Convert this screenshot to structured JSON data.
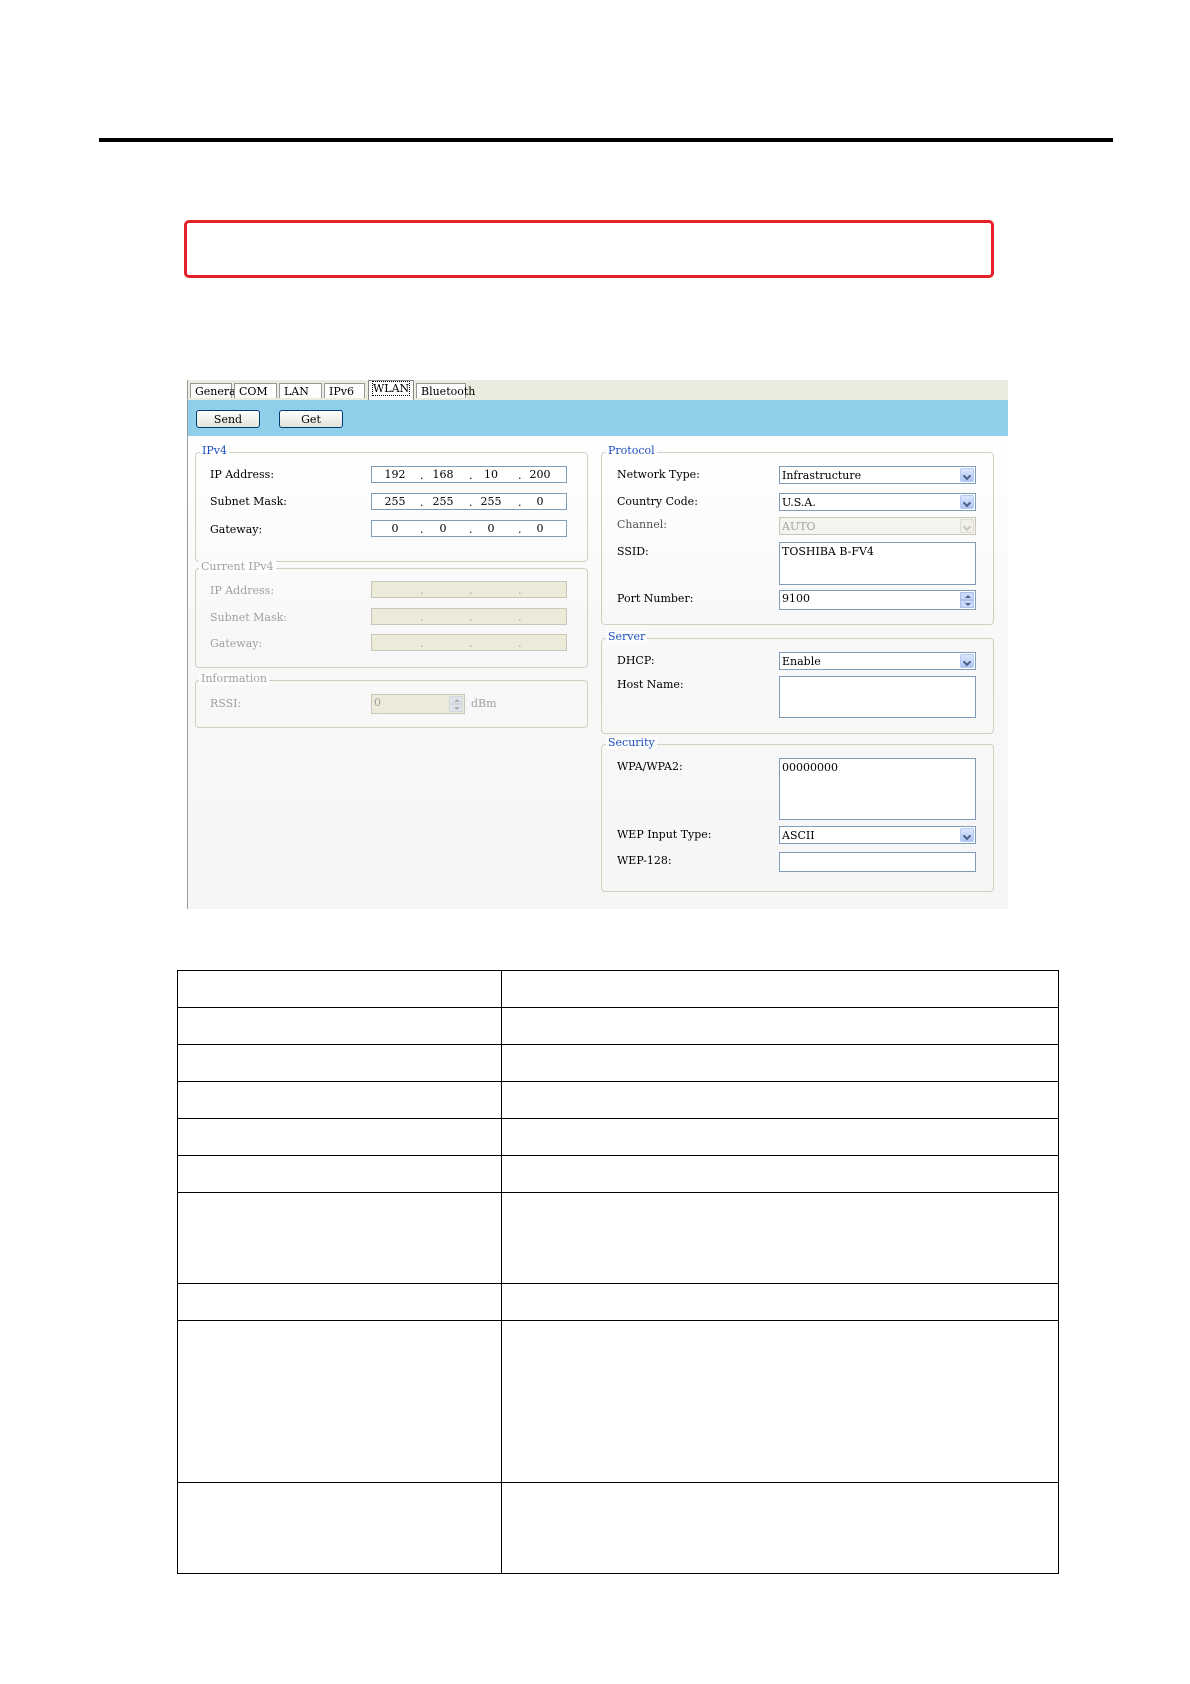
{
  "tabs": [
    "General",
    "COM",
    "LAN",
    "IPv6",
    "WLAN",
    "Bluetooth"
  ],
  "active_tab": "WLAN",
  "toolbar": {
    "send_label": "Send",
    "get_label": "Get"
  },
  "ipv4": {
    "legend": "IPv4",
    "ip_label": "IP Address:",
    "ip": [
      "192",
      "168",
      "10",
      "200"
    ],
    "mask_label": "Subnet Mask:",
    "mask": [
      "255",
      "255",
      "255",
      "0"
    ],
    "gateway_label": "Gateway:",
    "gateway": [
      "0",
      "0",
      "0",
      "0"
    ],
    "dot": "."
  },
  "current_ipv4": {
    "legend": "Current IPv4",
    "ip_label": "IP Address:",
    "mask_label": "Subnet Mask:",
    "gateway_label": "Gateway:"
  },
  "information": {
    "legend": "Information",
    "rssi_label": "RSSI:",
    "rssi_value": "0",
    "rssi_unit": "dBm"
  },
  "protocol": {
    "legend": "Protocol",
    "network_type_label": "Network Type:",
    "network_type": "Infrastructure",
    "country_code_label": "Country Code:",
    "country_code": "U.S.A.",
    "channel_label": "Channel:",
    "channel": "AUTO",
    "ssid_label": "SSID:",
    "ssid": "TOSHIBA B-FV4",
    "port_label": "Port Number:",
    "port": "9100"
  },
  "server": {
    "legend": "Server",
    "dhcp_label": "DHCP:",
    "dhcp": "Enable",
    "host_label": "Host Name:",
    "host": ""
  },
  "security": {
    "legend": "Security",
    "wpa_label": "WPA/WPA2:",
    "wpa": "00000000",
    "wep_input_label": "WEP Input Type:",
    "wep_input": "ASCII",
    "wep128_label": "WEP-128:",
    "wep128": ""
  },
  "colors": {
    "accent_rule": "#000000",
    "red_box": "#e8202a",
    "toolbar": "#8fcfe9",
    "group_title": "#1d4fbf"
  }
}
